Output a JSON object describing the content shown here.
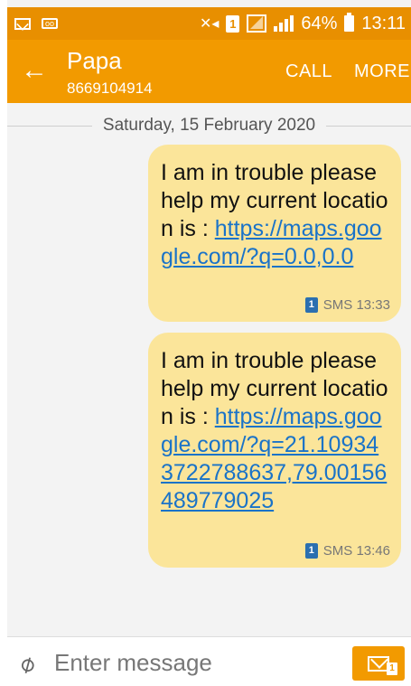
{
  "status_bar": {
    "battery": "64%",
    "time": "13:11",
    "sim_label": "1",
    "icons": [
      "mail-icon",
      "voicemail-icon",
      "mute-icon",
      "sim-icon",
      "signal-icon",
      "signal-bars-icon",
      "battery-icon"
    ]
  },
  "header": {
    "back_icon": "←",
    "contact_name": "Papa",
    "contact_number": "8669104914",
    "call_label": "CALL",
    "more_label": "MORE"
  },
  "conversation": {
    "date": "Saturday, 15 February 2020",
    "messages": [
      {
        "text": "I am in trouble please help my current location is : ",
        "link": "https://maps.google.com/?q=0.0,0.0",
        "sim": "1",
        "meta": "SMS 13:33"
      },
      {
        "text": "I am in trouble please help my current location is : ",
        "link": "https://maps.google.com/?q=21.109343722788637,79.00156489779025",
        "sim": "1",
        "meta": "SMS 13:46"
      }
    ]
  },
  "compose": {
    "placeholder": "Enter message",
    "send_sim": "1"
  },
  "colors": {
    "accent": "#f29a00",
    "bubble": "#fbe59a",
    "link": "#1a73c8"
  }
}
